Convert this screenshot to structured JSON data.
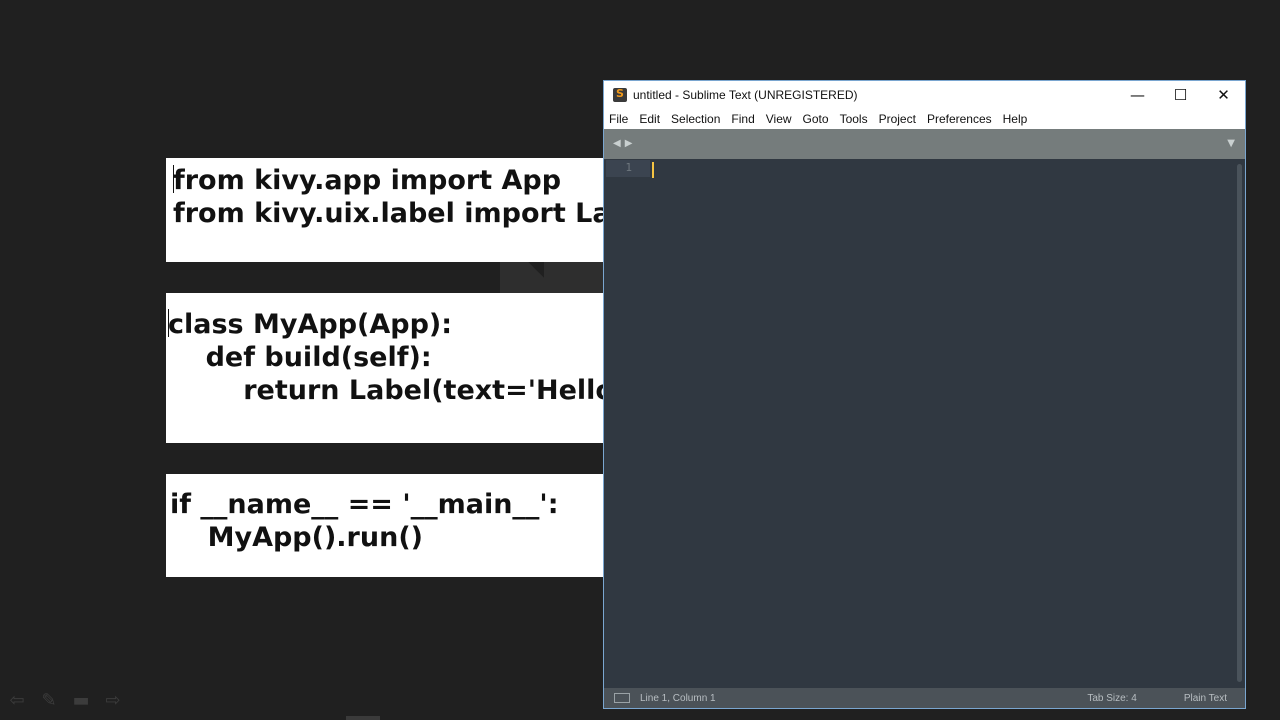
{
  "slide": {
    "code_block_1": [
      "from kivy.app import App",
      "from kivy.uix.label import Label"
    ],
    "code_block_2": [
      "class MyApp(App):",
      "    def build(self):",
      "        return Label(text='Hello world')"
    ],
    "code_block_3": [
      "if __name__ == '__main__':",
      "    MyApp().run()"
    ],
    "toolbar_icons": [
      "arrow-left-icon",
      "pen-icon",
      "screen-icon",
      "arrow-right-icon"
    ]
  },
  "window": {
    "title": "untitled - Sublime Text (UNREGISTERED)",
    "controls": {
      "minimize": "—",
      "maximize": "☐",
      "close": "✕"
    },
    "menu": [
      "File",
      "Edit",
      "Selection",
      "Find",
      "View",
      "Goto",
      "Tools",
      "Project",
      "Preferences",
      "Help"
    ],
    "tabbar": {
      "prev_arrow": "◀",
      "next_arrow": "▶",
      "dropdown": "▼"
    },
    "editor": {
      "line_number": "1"
    },
    "status": {
      "position": "Line 1, Column 1",
      "tab_size": "Tab Size: 4",
      "syntax": "Plain Text"
    },
    "colors": {
      "editor_bg": "#303841",
      "cursor": "#f5c443",
      "tabbar_bg": "#757c7c",
      "statusbar_bg": "#4b5258"
    }
  }
}
